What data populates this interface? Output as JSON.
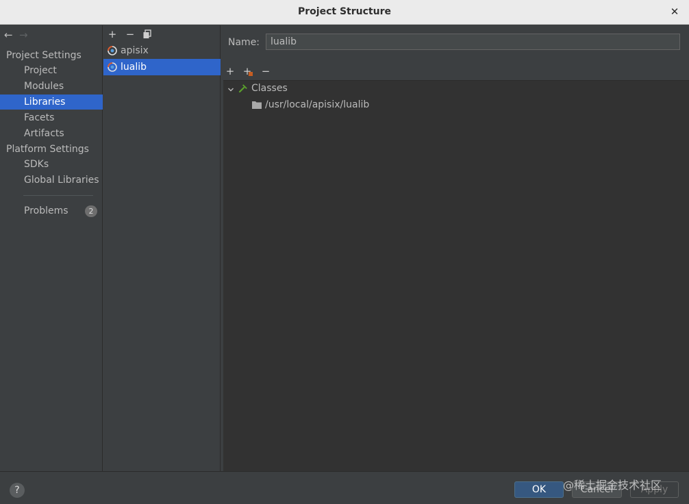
{
  "window": {
    "title": "Project Structure",
    "close_glyph": "✕"
  },
  "nav": {
    "back_glyph": "←",
    "forward_glyph": "→"
  },
  "sidebar": {
    "project_settings_header": "Project Settings",
    "project_items": [
      {
        "label": "Project",
        "selected": false
      },
      {
        "label": "Modules",
        "selected": false
      },
      {
        "label": "Libraries",
        "selected": true
      },
      {
        "label": "Facets",
        "selected": false
      },
      {
        "label": "Artifacts",
        "selected": false
      }
    ],
    "platform_settings_header": "Platform Settings",
    "platform_items": [
      {
        "label": "SDKs"
      },
      {
        "label": "Global Libraries"
      }
    ],
    "problems": {
      "label": "Problems",
      "count": "2"
    }
  },
  "libraries_toolbar": {
    "add": "+",
    "remove": "−",
    "copy_icon": "copy-icon"
  },
  "libraries": [
    {
      "name": "apisix",
      "selected": false
    },
    {
      "name": "lualib",
      "selected": true
    }
  ],
  "detail": {
    "name_label": "Name:",
    "name_value": "lualib",
    "toolbar": {
      "add": "+",
      "add_special": "+",
      "remove": "−"
    },
    "tree": {
      "root_label": "Classes",
      "root_expanded": true,
      "children": [
        {
          "path": "/usr/local/apisix/lualib"
        }
      ]
    }
  },
  "footer": {
    "help_glyph": "?",
    "ok_label": "OK",
    "cancel_label": "Cancel",
    "apply_label": "Apply",
    "watermark": "@稀土掘金技术社区"
  },
  "colors": {
    "selection": "#2f65ca",
    "background": "#3c3f41",
    "tree_background": "#323232",
    "ok_button": "#365880",
    "classes_icon": "#5aa02c"
  }
}
